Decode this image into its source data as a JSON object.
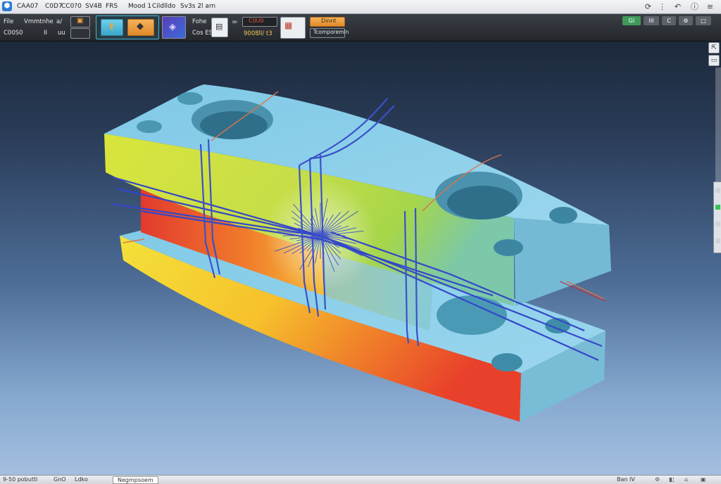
{
  "menubar": {
    "items": [
      "CAA07",
      "C0D7",
      "CC0?0",
      "SV4B",
      "FRS",
      "Mood 1",
      "Cildlldo",
      "Sv3s 2",
      "l arn"
    ],
    "right_icons": [
      "refresh-icon",
      "grid-icon",
      "back-icon",
      "info-icon",
      "menu-icon"
    ]
  },
  "ribbon": {
    "row1_labels": [
      "File",
      "Vmmtnhe",
      "a/"
    ],
    "row2_labels": [
      "C00S0",
      "II",
      "uu"
    ],
    "small_label_1": "Fohe",
    "small_label_2": "Cos ES",
    "field_left": "C0U0",
    "field_left_caption": "9008ll/ t3",
    "field_right_caption": "Dinnt",
    "field_right_button": "Tcomporemln",
    "top_right_buttons": [
      "Gl",
      "III",
      "C",
      ""
    ]
  },
  "viewport": {
    "accent_colors": {
      "part_top": "#8fd0ea",
      "gradient_hot": "#e8402a",
      "gradient_warm": "#f3d23a",
      "rays": "#3447c8"
    }
  },
  "statusbar": {
    "items": [
      "9-50 pobuttl",
      "GnO",
      "Ldko",
      "Negmpsoem"
    ],
    "right_text": "Ban IV"
  }
}
